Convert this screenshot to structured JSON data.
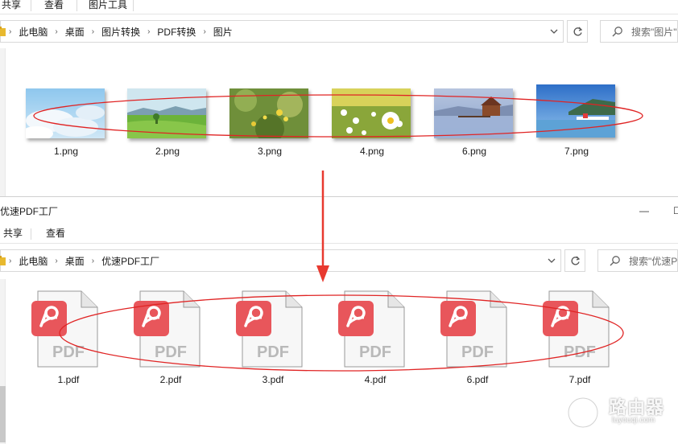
{
  "window1": {
    "ribbon_tabs": [
      "共享",
      "查看",
      "图片工具"
    ],
    "breadcrumb": [
      "此电脑",
      "桌面",
      "图片转换",
      "PDF转换",
      "图片"
    ],
    "search_placeholder": "搜索\"图片\"",
    "files": [
      "1.png",
      "2.png",
      "3.png",
      "4.png",
      "6.png",
      "7.png"
    ]
  },
  "window2": {
    "title": "优速PDF工厂",
    "ribbon_tabs": [
      "共享",
      "查看"
    ],
    "window_controls": [
      "—",
      "☐"
    ],
    "breadcrumb": [
      "此电脑",
      "桌面",
      "优速PDF工厂"
    ],
    "search_placeholder": "搜索\"优速PDF工厂\"",
    "file_badge_text": "PDF",
    "files": [
      "1.pdf",
      "2.pdf",
      "3.pdf",
      "4.pdf",
      "6.pdf",
      "7.pdf"
    ]
  },
  "annotations": {
    "highlight_color": "#e02424",
    "arrow": "arrow-down-icon"
  },
  "watermark": {
    "brand": "路由器",
    "url": "luyouqi.com"
  }
}
